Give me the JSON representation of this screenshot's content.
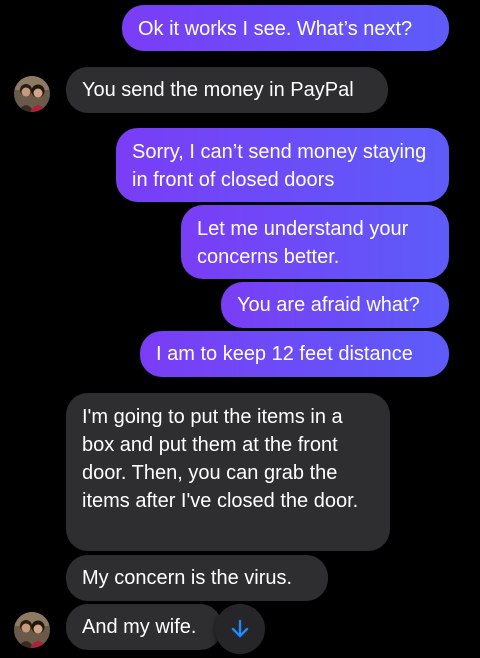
{
  "colors": {
    "background": "#000000",
    "outgoing_bubble": "#6a4ef8",
    "incoming_bubble": "#2e2e31",
    "scroll_arrow": "#1e88ff"
  },
  "messages": [
    {
      "direction": "outgoing",
      "text": "Ok it works I see. What’s next?"
    },
    {
      "direction": "incoming",
      "text": "You send the money in PayPal"
    },
    {
      "direction": "outgoing",
      "text": "Sorry, I can’t send money staying in front of closed doors"
    },
    {
      "direction": "outgoing",
      "text": "Let me understand your concerns better."
    },
    {
      "direction": "outgoing",
      "text": "You are afraid what?"
    },
    {
      "direction": "outgoing",
      "text": "I am to keep 12 feet distance"
    },
    {
      "direction": "incoming",
      "text": "I'm going to put the items in a box and put them at the front door. Then, you can grab the items after I've closed the door."
    },
    {
      "direction": "incoming",
      "text": "My concern is the virus."
    },
    {
      "direction": "incoming",
      "text": "And my wife."
    }
  ],
  "icons": {
    "avatar": "contact-avatar-icon",
    "scroll_to_bottom": "arrow-down-icon"
  }
}
